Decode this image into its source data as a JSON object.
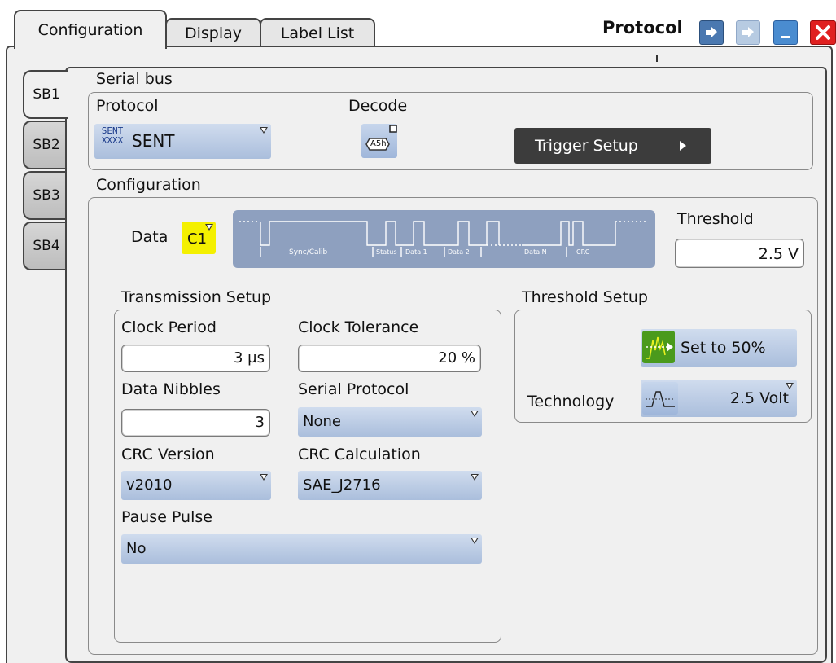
{
  "tabs": [
    "Configuration",
    "Display",
    "Label List"
  ],
  "window": {
    "title": "Protocol"
  },
  "serial_bus_tabs": [
    "SB1",
    "SB2",
    "SB3",
    "SB4"
  ],
  "serial_bus": {
    "heading": "Serial bus",
    "protocol_label": "Protocol",
    "protocol_icon_text": [
      "SENT",
      "XXXX"
    ],
    "protocol_value": "SENT",
    "decode_label": "Decode",
    "decode_icon_text": "A5h",
    "trigger_setup_label": "Trigger Setup"
  },
  "configuration": {
    "heading": "Configuration",
    "data_label": "Data",
    "data_source": "C1",
    "diagram_labels": [
      "Sync/Calib",
      "Status",
      "Data 1",
      "Data 2",
      "Data N",
      "CRC"
    ],
    "threshold_label": "Threshold",
    "threshold_value": "2.5 V"
  },
  "transmission_setup": {
    "heading": "Transmission Setup",
    "clock_period_label": "Clock Period",
    "clock_period_value": "3 µs",
    "clock_tolerance_label": "Clock Tolerance",
    "clock_tolerance_value": "20 %",
    "data_nibbles_label": "Data Nibbles",
    "data_nibbles_value": "3",
    "serial_protocol_label": "Serial Protocol",
    "serial_protocol_value": "None",
    "crc_version_label": "CRC Version",
    "crc_version_value": "v2010",
    "crc_calculation_label": "CRC Calculation",
    "crc_calculation_value": "SAE_J2716",
    "pause_pulse_label": "Pause Pulse",
    "pause_pulse_value": "No"
  },
  "threshold_setup": {
    "heading": "Threshold Setup",
    "set50_label": "Set to 50%",
    "technology_label": "Technology",
    "technology_value": "2.5 Volt"
  },
  "colors": {
    "combo": "#b8c8e4",
    "trigger_button": "#3c3c3c",
    "source_badge": "#f4f000",
    "close": "#e02020",
    "title_button": "#4a78b0",
    "diagram_bg": "#8ea0bf"
  }
}
